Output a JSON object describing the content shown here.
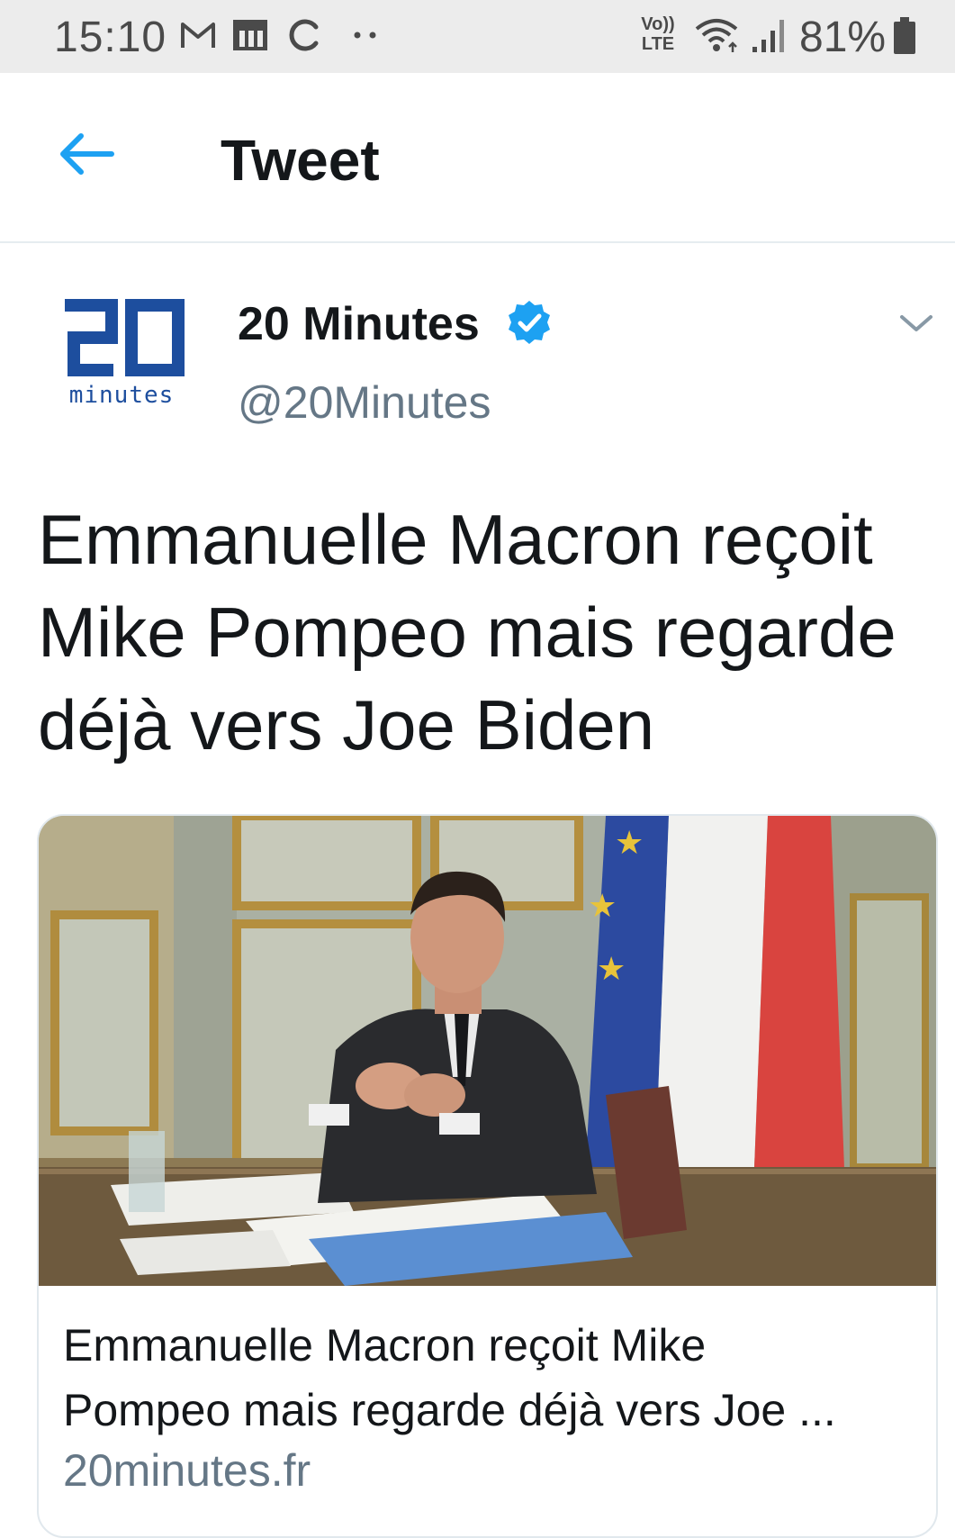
{
  "status_bar": {
    "time": "15:10",
    "left_icons": [
      "gmail-icon",
      "news-icon",
      "sync-icon",
      "more-dots-icon"
    ],
    "volte_top": "Vo))",
    "volte_bottom": "LTE",
    "battery": "81%"
  },
  "header": {
    "back_icon": "arrow-left-icon",
    "title": "Tweet"
  },
  "tweet": {
    "author_name": "20 Minutes",
    "author_handle": "@20Minutes",
    "avatar_logo_text": "20",
    "avatar_logo_sub": "minutes",
    "verified": true,
    "text": "Emmanuelle Macron reçoit Mike Pompeo mais regarde déjà vers Joe Biden"
  },
  "card": {
    "title_line1": "Emmanuelle Macron reçoit Mike",
    "title_line2": "Pompeo mais regarde déjà vers Joe ...",
    "domain": "20minutes.fr"
  },
  "colors": {
    "status_bar_bg": "#ececec",
    "twitter_blue": "#1da1f2",
    "text_primary": "#14171a",
    "text_secondary": "#657786",
    "logo_blue": "#1d4e9e",
    "flag_blue": "#2c4aa0",
    "flag_red": "#d9443f"
  }
}
